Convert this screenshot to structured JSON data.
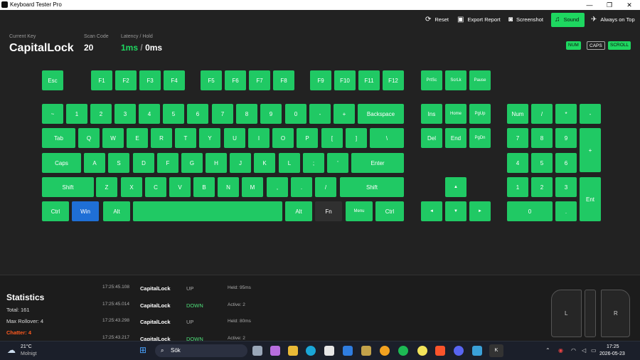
{
  "window": {
    "title": "Keyboard Tester Pro",
    "minimize": "—",
    "maximize": "❐",
    "close": "✕"
  },
  "toolbar": {
    "reset": "Reset",
    "export": "Export Report",
    "screenshot": "Screenshot",
    "sound": "Sound",
    "ontop": "Always on Top"
  },
  "info": {
    "current_key_label": "Current Key",
    "current_key": "CapitalLock",
    "scan_code_label": "Scan Code",
    "scan_code": "20",
    "latency_label": "Latency / Hold",
    "latency": "1ms",
    "latency_sep": "/",
    "hold": "0ms"
  },
  "indicators": {
    "num": "NUM",
    "caps": "CAPS",
    "scroll": "SCROLL"
  },
  "keys": {
    "esc": "Esc",
    "f1": "F1",
    "f2": "F2",
    "f3": "F3",
    "f4": "F4",
    "f5": "F5",
    "f6": "F6",
    "f7": "F7",
    "f8": "F8",
    "f9": "F9",
    "f10": "F10",
    "f11": "F11",
    "f12": "F12",
    "prtsc": "PrtSc",
    "scrlk": "ScrLk",
    "pause": "Pause",
    "tilde": "~",
    "d1": "1",
    "d2": "2",
    "d3": "3",
    "d4": "4",
    "d5": "5",
    "d6": "6",
    "d7": "7",
    "d8": "8",
    "d9": "9",
    "d0": "0",
    "minus": "-",
    "plus": "+",
    "backspace": "Backspace",
    "ins": "Ins",
    "home": "Home",
    "pgup": "PgUp",
    "numlock": "Num",
    "ndiv": "/",
    "nmul": "*",
    "nminus": "-",
    "tab": "Tab",
    "q": "Q",
    "w": "W",
    "e": "E",
    "r": "R",
    "t": "T",
    "y": "Y",
    "u": "U",
    "i": "I",
    "o": "O",
    "p": "P",
    "lbr": "[",
    "rbr": "]",
    "bslash": "\\",
    "del": "Del",
    "end": "End",
    "pgdn": "PgDn",
    "n7": "7",
    "n8": "8",
    "n9": "9",
    "nplus": "+",
    "caps": "Caps",
    "a": "A",
    "s": "S",
    "d": "D",
    "f": "F",
    "g": "G",
    "h": "H",
    "j": "J",
    "k": "K",
    "l": "L",
    "semi": ";",
    "quote": "'",
    "enter": "Enter",
    "n4": "4",
    "n5": "5",
    "n6": "6",
    "lshift": "Shift",
    "z": "Z",
    "x": "X",
    "c": "C",
    "v": "V",
    "b": "B",
    "n": "N",
    "m": "M",
    "comma": ",",
    "period": ".",
    "slash": "/",
    "rshift": "Shift",
    "up": "▲",
    "n1": "1",
    "n2": "2",
    "n3": "3",
    "nent": "Ent",
    "lctrl": "Ctrl",
    "win": "Win",
    "lalt": "Alt",
    "space": "",
    "ralt": "Alt",
    "fn": "Fn",
    "menu": "Menu",
    "rctrl": "Ctrl",
    "left": "◄",
    "down": "▼",
    "right": "►",
    "n0": "0",
    "ndot": "."
  },
  "stats": {
    "title": "Statistics",
    "total": "Total: 161",
    "rollover": "Max Rollover: 4",
    "chatter": "Chatter: 4"
  },
  "log": [
    {
      "time": "17:25:45.108",
      "key": "CapitalLock",
      "state": "UP",
      "detail": "Held: 95ms"
    },
    {
      "time": "17:25:45.014",
      "key": "CapitalLock",
      "state": "DOWN",
      "detail": "Active: 2"
    },
    {
      "time": "17:25:43.298",
      "key": "CapitalLock",
      "state": "UP",
      "detail": "Held: 80ms"
    },
    {
      "time": "17:25:43.217",
      "key": "CapitalLock",
      "state": "DOWN",
      "detail": "Active: 2"
    }
  ],
  "mouse": {
    "left": "L",
    "right": "R"
  },
  "taskbar": {
    "temp": "21°C",
    "weather": "Molnigt",
    "search": "Sök",
    "time": "17:25",
    "date": "2026-05-23",
    "active_app": "K"
  },
  "colors": {
    "key": "#20c964",
    "pressed": "#1f6fd6",
    "accent": "#1ed760",
    "chatter": "#ff5a1f",
    "up": "#aaaaaa",
    "down": "#4fe07a"
  }
}
